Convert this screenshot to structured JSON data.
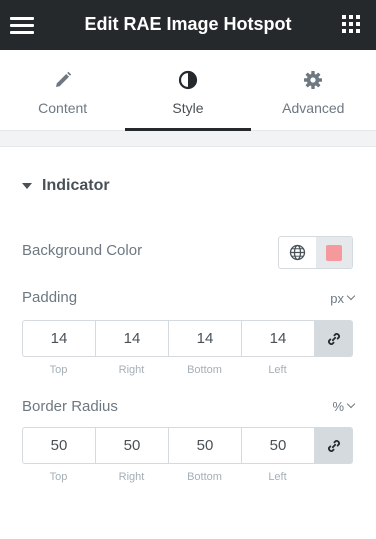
{
  "header": {
    "title": "Edit RAE Image Hotspot",
    "menu_icon": "hamburger-icon",
    "grid_icon": "apps-grid-icon"
  },
  "tabs": [
    {
      "label": "Content",
      "icon": "pencil-icon",
      "active": false
    },
    {
      "label": "Style",
      "icon": "half-circle-contrast-icon",
      "active": true
    },
    {
      "label": "Advanced",
      "icon": "gear-icon",
      "active": false
    }
  ],
  "section": {
    "title": "Indicator",
    "expanded": true
  },
  "background_color": {
    "label": "Background Color",
    "global_icon": "globe-icon",
    "swatch_color": "#f5999c"
  },
  "padding": {
    "label": "Padding",
    "unit": "px",
    "top": "14",
    "right": "14",
    "bottom": "14",
    "left": "14",
    "labels": [
      "Top",
      "Right",
      "Bottom",
      "Left"
    ],
    "link_icon": "link-icon"
  },
  "border_radius": {
    "label": "Border Radius",
    "unit": "%",
    "top": "50",
    "right": "50",
    "bottom": "50",
    "left": "50",
    "labels": [
      "Top",
      "Right",
      "Bottom",
      "Left"
    ],
    "link_icon": "link-icon"
  },
  "colors": {
    "header_bg": "#26292c",
    "panel_bg": "#ffffff",
    "accent": "#26292c"
  }
}
